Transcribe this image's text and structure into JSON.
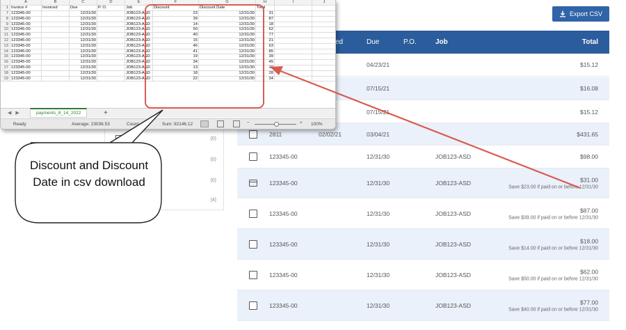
{
  "toolbar": {
    "export_label": "Export CSV"
  },
  "table": {
    "headers": {
      "invoiced": "ced",
      "due": "Due",
      "po": "P.O.",
      "job": "Job",
      "total": "Total"
    },
    "rows": [
      {
        "invoice": "",
        "invoiced": "/21",
        "due": "04/23/21",
        "job": "",
        "amount": "$15.12",
        "save": "",
        "marker": "none",
        "alt": false
      },
      {
        "invoice": "",
        "invoiced": "/21",
        "due": "07/15/21",
        "job": "",
        "amount": "$16.08",
        "save": "",
        "marker": "none",
        "alt": true
      },
      {
        "invoice": "",
        "invoiced": "/21",
        "due": "07/15/21",
        "job": "",
        "amount": "$15.12",
        "save": "",
        "marker": "none",
        "alt": false
      },
      {
        "invoice": "2811",
        "invoiced": "02/02/21",
        "due": "03/04/21",
        "job": "",
        "amount": "$431.65",
        "save": "",
        "marker": "checkbox",
        "alt": true
      },
      {
        "invoice": "123345-00",
        "invoiced": "",
        "due": "12/31/30",
        "job": "JOB123-ASD",
        "amount": "$98.00",
        "save": "",
        "marker": "checkbox",
        "alt": false
      },
      {
        "invoice": "123345-00",
        "invoiced": "",
        "due": "12/31/30",
        "job": "JOB123-ASD",
        "amount": "$31.00",
        "save": "Save $23.00 if paid on or before 12/31/30",
        "marker": "payment",
        "alt": true
      },
      {
        "invoice": "123345-00",
        "invoiced": "",
        "due": "12/31/30",
        "job": "JOB123-ASD",
        "amount": "$87.00",
        "save": "Save $39.00 if paid on or before 12/31/30",
        "marker": "checkbox",
        "alt": false
      },
      {
        "invoice": "123345-00",
        "invoiced": "",
        "due": "12/31/30",
        "job": "JOB123-ASD",
        "amount": "$18.00",
        "save": "Save $14.00 if paid on or before 12/31/30",
        "marker": "checkbox",
        "alt": true
      },
      {
        "invoice": "123345-00",
        "invoiced": "",
        "due": "12/31/30",
        "job": "JOB123-ASD",
        "amount": "$62.00",
        "save": "Save $50.00 if paid on or before 12/31/30",
        "marker": "checkbox",
        "alt": false
      },
      {
        "invoice": "123345-00",
        "invoiced": "",
        "due": "12/31/30",
        "job": "JOB123-ASD",
        "amount": "$77.00",
        "save": "Save $40.00 if paid on or before 12/31/30",
        "marker": "checkbox",
        "alt": true
      }
    ]
  },
  "filter_panel": {
    "items": [
      {
        "label": "d 2",
        "count": "(0)"
      },
      {
        "label": "",
        "count": "(0)"
      },
      {
        "label": "",
        "count": "(0)"
      },
      {
        "label": "",
        "count": "(4)"
      }
    ]
  },
  "excel": {
    "col_letters": [
      "A",
      "B",
      "C",
      "D",
      "E",
      "F",
      "G",
      "H",
      "I",
      "J"
    ],
    "header_row": {
      "num": "1",
      "cells": [
        "Invoice #",
        "Invoiced",
        "Due",
        "P. O.",
        "Job",
        "Discount",
        "Discount Date",
        "Total",
        "",
        ""
      ]
    },
    "data_rows": [
      {
        "num": "7",
        "invoice": "123345-00",
        "due": "12/31/30",
        "job": "JOB123-ASD",
        "discount": "23",
        "disc_date": "12/31/30",
        "total": "31"
      },
      {
        "num": "8",
        "invoice": "123345-00",
        "due": "12/31/30",
        "job": "JOB123-ASD",
        "discount": "39",
        "disc_date": "12/31/30",
        "total": "87"
      },
      {
        "num": "9",
        "invoice": "123345-00",
        "due": "12/31/30",
        "job": "JOB123-ASD",
        "discount": "14",
        "disc_date": "12/31/30",
        "total": "18"
      },
      {
        "num": "10",
        "invoice": "123345-00",
        "due": "12/31/30",
        "job": "JOB123-ASD",
        "discount": "50",
        "disc_date": "12/31/30",
        "total": "62"
      },
      {
        "num": "11",
        "invoice": "123345-00",
        "due": "12/31/30",
        "job": "JOB123-ASD",
        "discount": "40",
        "disc_date": "12/31/30",
        "total": "77"
      },
      {
        "num": "12",
        "invoice": "123345-00",
        "due": "12/31/30",
        "job": "JOB123-ASD",
        "discount": "15",
        "disc_date": "12/31/30",
        "total": "21"
      },
      {
        "num": "13",
        "invoice": "123345-00",
        "due": "12/31/30",
        "job": "JOB123-ASD",
        "discount": "46",
        "disc_date": "12/31/30",
        "total": "63"
      },
      {
        "num": "14",
        "invoice": "123345-00",
        "due": "12/31/30",
        "job": "JOB123-ASD",
        "discount": "41",
        "disc_date": "12/31/30",
        "total": "85"
      },
      {
        "num": "15",
        "invoice": "123345-00",
        "due": "12/31/30",
        "job": "JOB123-ASD",
        "discount": "19",
        "disc_date": "12/31/30",
        "total": "39"
      },
      {
        "num": "16",
        "invoice": "123345-00",
        "due": "12/31/30",
        "job": "JOB123-ASD",
        "discount": "34",
        "disc_date": "12/31/30",
        "total": "45"
      },
      {
        "num": "17",
        "invoice": "123345-00",
        "due": "12/31/30",
        "job": "JOB123-ASD",
        "discount": "13",
        "disc_date": "12/31/30",
        "total": "19"
      },
      {
        "num": "18",
        "invoice": "123345-00",
        "due": "12/31/30",
        "job": "JOB123-ASD",
        "discount": "18",
        "disc_date": "12/31/30",
        "total": "28"
      },
      {
        "num": "19",
        "invoice": "123345-00",
        "due": "12/31/30",
        "job": "JOB123-ASD",
        "discount": "22",
        "disc_date": "12/31/30",
        "total": "34"
      }
    ],
    "sheet_tab": "payments_8_14_2022",
    "add_sheet": "+",
    "status": {
      "ready": "Ready",
      "average": "Average: 23036.53",
      "count": "Count",
      "sum": "Sum: 92146.12",
      "zoom_minus": "−",
      "zoom_plus": "+",
      "zoom": "100%"
    }
  },
  "callout": {
    "text": "Discount and Discount Date in csv download"
  },
  "colors": {
    "header_blue": "#2b5c9b",
    "button_blue": "#2f64a8",
    "row_alt": "#eaf1fa",
    "annotation_red": "#d95b50",
    "excel_green": "#2e7d32"
  }
}
